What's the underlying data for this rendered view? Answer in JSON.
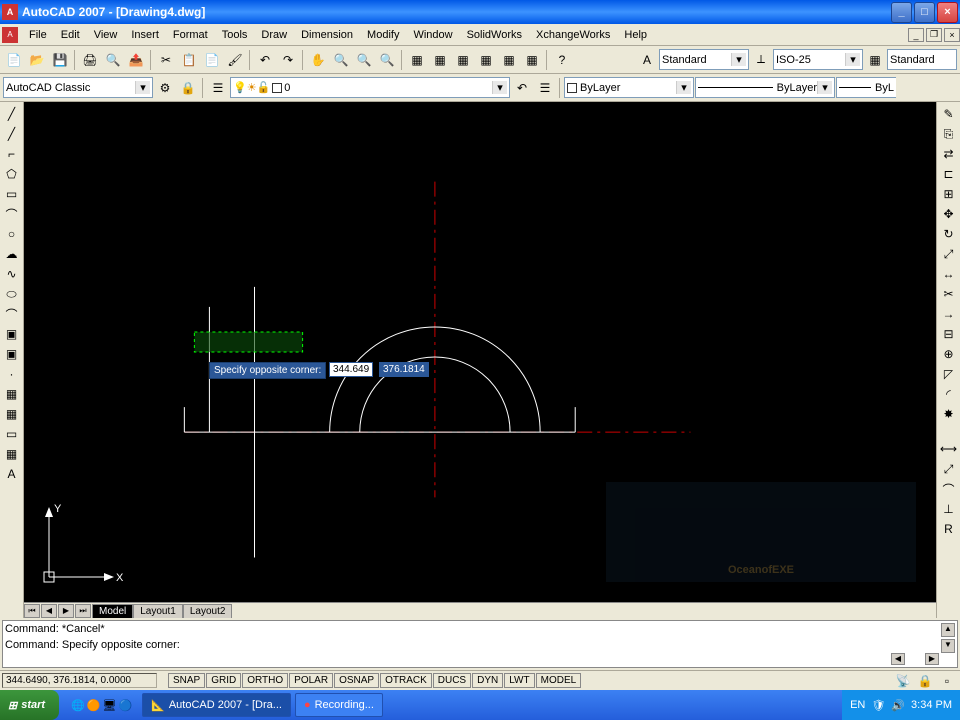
{
  "title": "AutoCAD 2007 - [Drawing4.dwg]",
  "menu": [
    "File",
    "Edit",
    "View",
    "Insert",
    "Format",
    "Tools",
    "Draw",
    "Dimension",
    "Modify",
    "Window",
    "SolidWorks",
    "XchangeWorks",
    "Help"
  ],
  "toolbar1": {
    "style_text": "Standard",
    "style_dim": "ISO-25",
    "style_right": "Standard"
  },
  "toolbar2": {
    "workspace": "AutoCAD Classic",
    "layer": "0",
    "color": "ByLayer",
    "linetype": "ByLayer",
    "lineweight": "ByL"
  },
  "tabs": {
    "model": "Model",
    "layout1": "Layout1",
    "layout2": "Layout2"
  },
  "cmd_line1": "Command: *Cancel*",
  "cmd_line2": "Command: Specify opposite corner:",
  "status": {
    "coords": "344.6490, 376.1814, 0.0000",
    "buttons": [
      "SNAP",
      "GRID",
      "ORTHO",
      "POLAR",
      "OSNAP",
      "OTRACK",
      "DUCS",
      "DYN",
      "LWT",
      "MODEL"
    ]
  },
  "tooltip": "Specify opposite corner:",
  "coord_x": "344.649",
  "coord_y": "376.1814",
  "taskbar": {
    "start": "start",
    "app1": "AutoCAD 2007 - [Dra...",
    "app2": "Recording...",
    "lang": "EN",
    "time": "3:34 PM"
  },
  "watermark": "OceanofEXE",
  "ucs_y": "Y",
  "ucs_x": "X"
}
